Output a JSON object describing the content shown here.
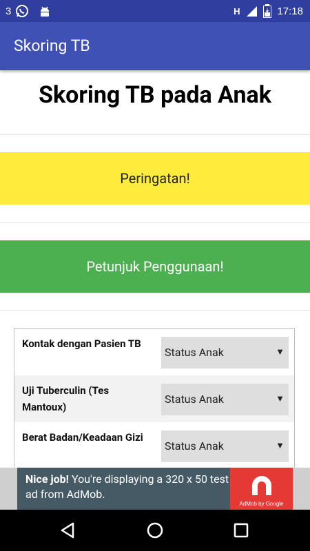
{
  "status_bar": {
    "notification_count": "3",
    "network_type": "H",
    "time": "17:18",
    "icons": [
      "whatsapp-icon",
      "android-icon",
      "signal-icon",
      "battery-icon"
    ]
  },
  "app_bar": {
    "title": "Skoring TB"
  },
  "main": {
    "heading": "Skoring TB pada Anak",
    "warning_button": "Peringatan!",
    "guide_button": "Petunjuk Penggunaan!",
    "rows": [
      {
        "label": "Kontak dengan Pasien TB",
        "value": "Status Anak"
      },
      {
        "label": "Uji Tuberculin (Tes Mantoux)",
        "value": "Status Anak"
      },
      {
        "label": "Berat Badan/Keadaan Gizi",
        "value": "Status Anak"
      }
    ]
  },
  "ad": {
    "headline": "Nice job!",
    "body": "You're displaying a 320 x 50 test ad from AdMob.",
    "brand": "AdMob by Google"
  },
  "colors": {
    "status_bar": "#303f9f",
    "app_bar": "#3f51b5",
    "warning": "#ffeb3b",
    "guide": "#4caf50",
    "ad_bg": "#455a64",
    "ad_logo": "#e53935"
  }
}
